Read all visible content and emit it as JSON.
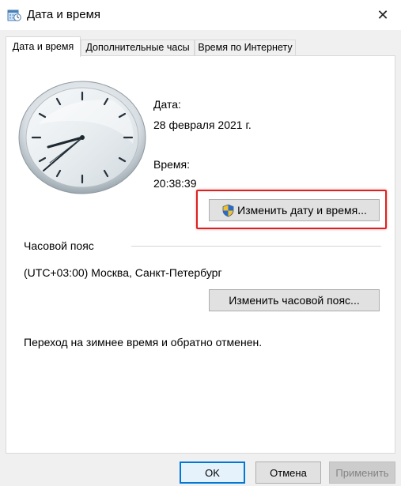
{
  "window": {
    "title": "Дата и время",
    "close_glyph": "✕"
  },
  "tabs": [
    {
      "label": "Дата и время",
      "active": true
    },
    {
      "label": "Дополнительные часы",
      "active": false
    },
    {
      "label": "Время по Интернету",
      "active": false
    }
  ],
  "date": {
    "label": "Дата:",
    "value": "28 февраля 2021 г."
  },
  "time": {
    "label": "Время:",
    "value": "20:38:39"
  },
  "change_datetime_button": {
    "label": "Изменить дату и время...",
    "icon": "uac-shield-icon"
  },
  "timezone": {
    "heading": "Часовой пояс",
    "value": "(UTC+03:00) Москва, Санкт-Петербург",
    "change_button": "Изменить часовой пояс..."
  },
  "dst_note": "Переход на зимнее время и обратно отменен.",
  "footer": {
    "ok": "OK",
    "cancel": "Отмена",
    "apply": "Применить"
  },
  "colors": {
    "highlight": "#e02020",
    "accent": "#0078d7"
  }
}
